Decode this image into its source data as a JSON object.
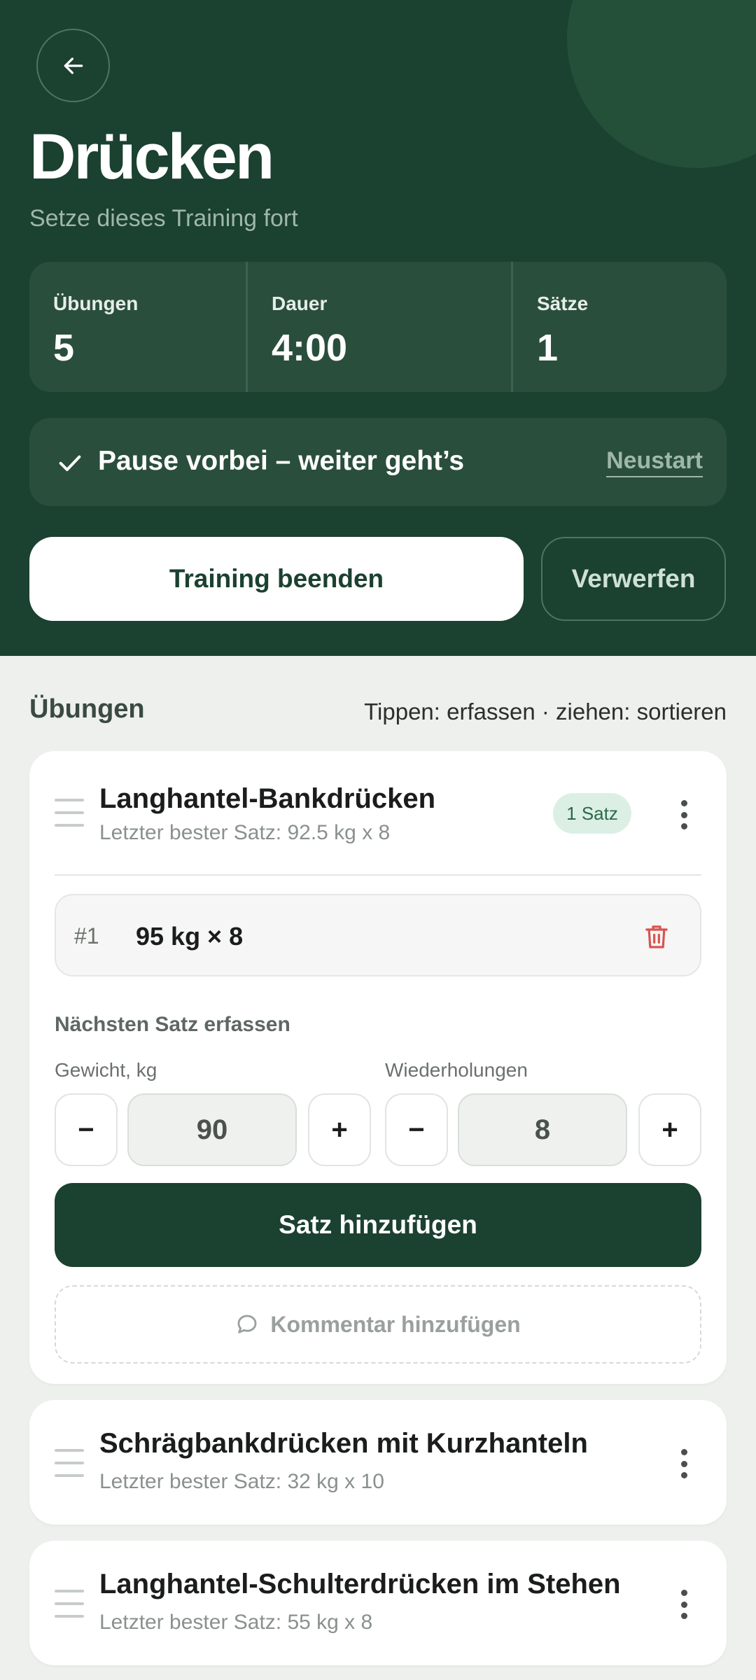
{
  "header": {
    "title": "Drücken",
    "subtitle": "Setze dieses Training fort",
    "stats": [
      {
        "label": "Übungen",
        "value": "5"
      },
      {
        "label": "Dauer",
        "value": "4:00"
      },
      {
        "label": "Sätze",
        "value": "1"
      }
    ],
    "pause": {
      "text": "Pause vorbei – weiter geht’s",
      "link": "Neustart"
    },
    "end_button": "Training beenden",
    "discard_button": "Verwerfen"
  },
  "section": {
    "title": "Übungen",
    "hint": "Tippen: erfassen · ziehen: sortieren"
  },
  "exercises": [
    {
      "name": "Langhantel-Bankdrücken",
      "last_best": "Letzter bester Satz: 92.5 kg x 8",
      "badge": "1 Satz",
      "sets": [
        {
          "num": "#1",
          "value": "95 kg × 8"
        }
      ],
      "next_set_label": "Nächsten Satz erfassen",
      "weight_label": "Gewicht, kg",
      "reps_label": "Wiederholungen",
      "weight_value": "90",
      "reps_value": "8",
      "minus": "−",
      "plus": "+",
      "add_button": "Satz hinzufügen",
      "comment_button": "Kommentar hinzufügen"
    },
    {
      "name": "Schrägbankdrücken mit Kurzhanteln",
      "last_best": "Letzter bester Satz: 32 kg x 10"
    },
    {
      "name": "Langhantel-Schulterdrücken im Stehen",
      "last_best": "Letzter bester Satz: 55 kg x 8"
    }
  ],
  "icons": {
    "back": "arrow-left-icon",
    "check": "check-icon",
    "trash": "trash-icon",
    "comment": "comment-icon",
    "drag": "drag-handle-icon",
    "more": "more-vertical-icon"
  },
  "colors": {
    "header_bg": "#1b4130",
    "accent_dark_green": "#1b4130",
    "badge_bg": "#dcefe4",
    "delete_red": "#d9534f"
  }
}
